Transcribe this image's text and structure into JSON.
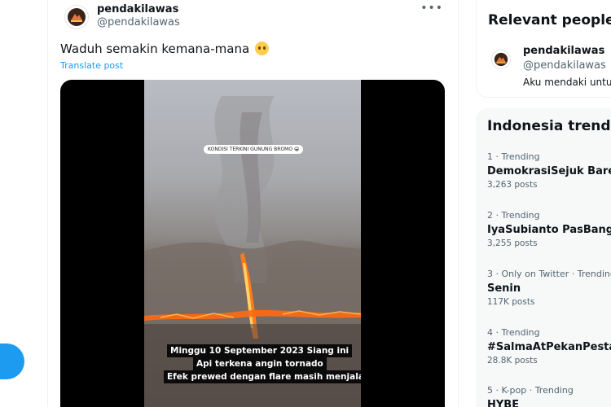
{
  "post": {
    "author_name": "pendakilawas",
    "author_handle": "@pendakilawas",
    "more_icon": "•••",
    "text": "Waduh semakin kemana-mana",
    "emoji": "pleading-face",
    "translate_label": "Translate post",
    "video": {
      "top_caption": "KONDISI TERKINI GUNUNG BROMO 😁",
      "caption_line1": "Minggu 10 September 2023 Siang ini",
      "caption_line2": "Api terkena angin tornado",
      "caption_line3": "Efek prewed dengan flare masih menjalar"
    }
  },
  "relevant_people": {
    "title": "Relevant people",
    "person": {
      "name": "pendakilawas",
      "handle": "@pendakilawas",
      "bio": "Aku mendaki untuk"
    }
  },
  "trends": {
    "title": "Indonesia trends",
    "items": [
      {
        "meta": "1 · Trending",
        "name": "DemokrasiSejuk BarengP",
        "count": "3,263 posts"
      },
      {
        "meta": "2 · Trending",
        "name": "IyaSubianto PasBanget",
        "count": "3,255 posts"
      },
      {
        "meta": "3 · Only on Twitter · Trending",
        "name": "Senin",
        "count": "117K posts"
      },
      {
        "meta": "4 · Trending",
        "name": "#SalmaAtPekanPesta",
        "count": "28.8K posts"
      },
      {
        "meta": "5 · K-pop · Trending",
        "name": "HYBE",
        "count": ""
      }
    ]
  },
  "colors": {
    "accent": "#1d9bf0",
    "text_primary": "#0f1419",
    "text_secondary": "#536471",
    "card_bg": "#f7f9f9"
  }
}
